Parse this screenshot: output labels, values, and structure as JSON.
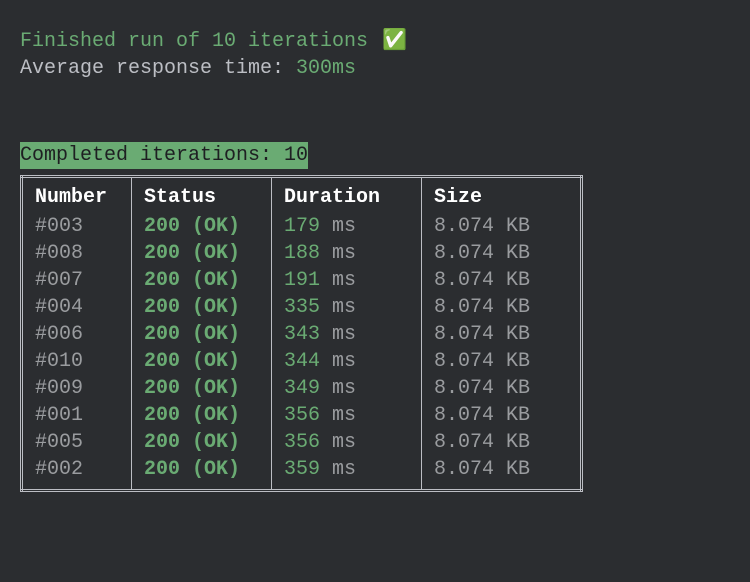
{
  "header": {
    "finished_text": "Finished run of 10 iterations",
    "check_icon": "✅",
    "avg_label": "Average response time: ",
    "avg_value": "300ms"
  },
  "section": {
    "title": "Completed iterations: 10"
  },
  "table": {
    "headers": {
      "number": "Number",
      "status": "Status",
      "duration": "Duration",
      "size": "Size"
    },
    "rows": [
      {
        "number": "#003",
        "status": "200 (OK)",
        "duration_value": "179",
        "duration_unit": "ms",
        "size": "8.074 KB"
      },
      {
        "number": "#008",
        "status": "200 (OK)",
        "duration_value": "188",
        "duration_unit": "ms",
        "size": "8.074 KB"
      },
      {
        "number": "#007",
        "status": "200 (OK)",
        "duration_value": "191",
        "duration_unit": "ms",
        "size": "8.074 KB"
      },
      {
        "number": "#004",
        "status": "200 (OK)",
        "duration_value": "335",
        "duration_unit": "ms",
        "size": "8.074 KB"
      },
      {
        "number": "#006",
        "status": "200 (OK)",
        "duration_value": "343",
        "duration_unit": "ms",
        "size": "8.074 KB"
      },
      {
        "number": "#010",
        "status": "200 (OK)",
        "duration_value": "344",
        "duration_unit": "ms",
        "size": "8.074 KB"
      },
      {
        "number": "#009",
        "status": "200 (OK)",
        "duration_value": "349",
        "duration_unit": "ms",
        "size": "8.074 KB"
      },
      {
        "number": "#001",
        "status": "200 (OK)",
        "duration_value": "356",
        "duration_unit": "ms",
        "size": "8.074 KB"
      },
      {
        "number": "#005",
        "status": "200 (OK)",
        "duration_value": "356",
        "duration_unit": "ms",
        "size": "8.074 KB"
      },
      {
        "number": "#002",
        "status": "200 (OK)",
        "duration_value": "359",
        "duration_unit": "ms",
        "size": "8.074 KB"
      }
    ]
  }
}
